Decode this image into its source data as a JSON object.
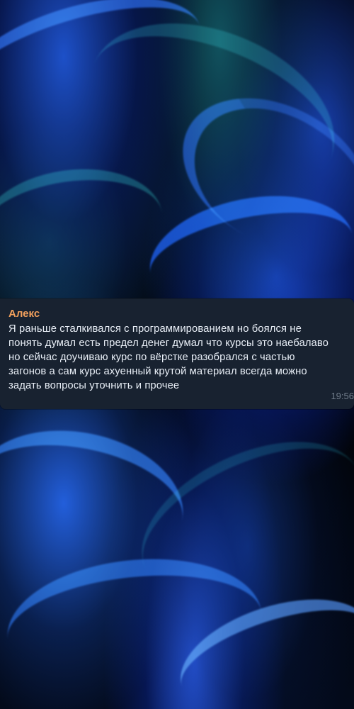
{
  "message": {
    "author": "Алекс",
    "text": "Я раньше сталкивался с программированием но боялся не понять думал есть предел денег думал что курсы это наебалаво но сейчас доучиваю курс по вёрстке разобрался с частью загонов а сам курс ахуенный крутой материал всегда можно задать вопросы уточнить и прочее",
    "time": "19:56"
  },
  "colors": {
    "author": "#f3a15d",
    "bubble_background": "#182230",
    "text": "#e8eef6",
    "time": "#a7b4c2"
  }
}
